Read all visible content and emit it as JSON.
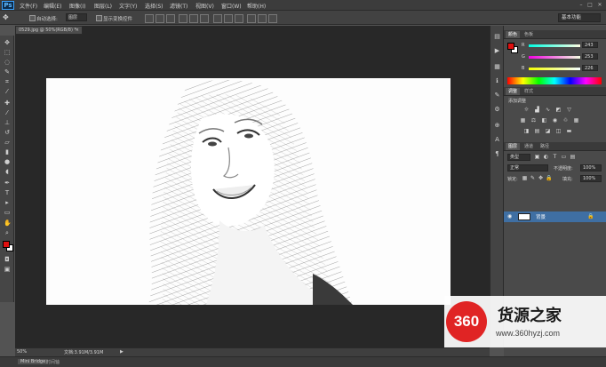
{
  "app": {
    "logo": "Ps"
  },
  "menu": [
    "文件(F)",
    "编辑(E)",
    "图像(I)",
    "图层(L)",
    "文字(Y)",
    "选择(S)",
    "滤镜(T)",
    "视图(V)",
    "窗口(W)",
    "帮助(H)"
  ],
  "window_controls": {
    "minimize": "–",
    "maximize": "□",
    "close": "✕"
  },
  "options": {
    "auto_select": "自动选择:",
    "auto_select_value": "图层",
    "show_transform": "显示变换控件"
  },
  "workspace": "基本功能",
  "document": {
    "tab_title": "0529.jpg @ 50%(RGB/8) *",
    "close": "×"
  },
  "status": {
    "zoom": "50%",
    "doc_info": "文档:3.91M/3.91M"
  },
  "bottom_tabs": [
    "Mini Bridge",
    "时间轴"
  ],
  "color_panel": {
    "tabs": [
      "颜色",
      "色板"
    ],
    "channels": [
      {
        "label": "R",
        "value": "243"
      },
      {
        "label": "G",
        "value": "253"
      },
      {
        "label": "B",
        "value": "226"
      }
    ]
  },
  "adjust_panel": {
    "tabs": [
      "调整",
      "样式"
    ],
    "title": "添加调整"
  },
  "layers_panel": {
    "tabs": [
      "图层",
      "通道",
      "路径"
    ],
    "kind": "类型",
    "blend_mode": "正常",
    "opacity_label": "不透明度:",
    "opacity": "100%",
    "lock_label": "锁定:",
    "fill_label": "填充:",
    "fill": "100%",
    "layer_name": "背景",
    "bottom_icons": [
      "link-icon",
      "fx-icon",
      "mask-icon",
      "adjustment-icon",
      "folder-icon",
      "new-layer-icon",
      "trash-icon"
    ]
  },
  "watermark": {
    "badge": "360",
    "name": "货源之家",
    "url": "www.360hyzj.com"
  },
  "colors": {
    "foreground": "#e01010",
    "background": "#ffffff"
  }
}
